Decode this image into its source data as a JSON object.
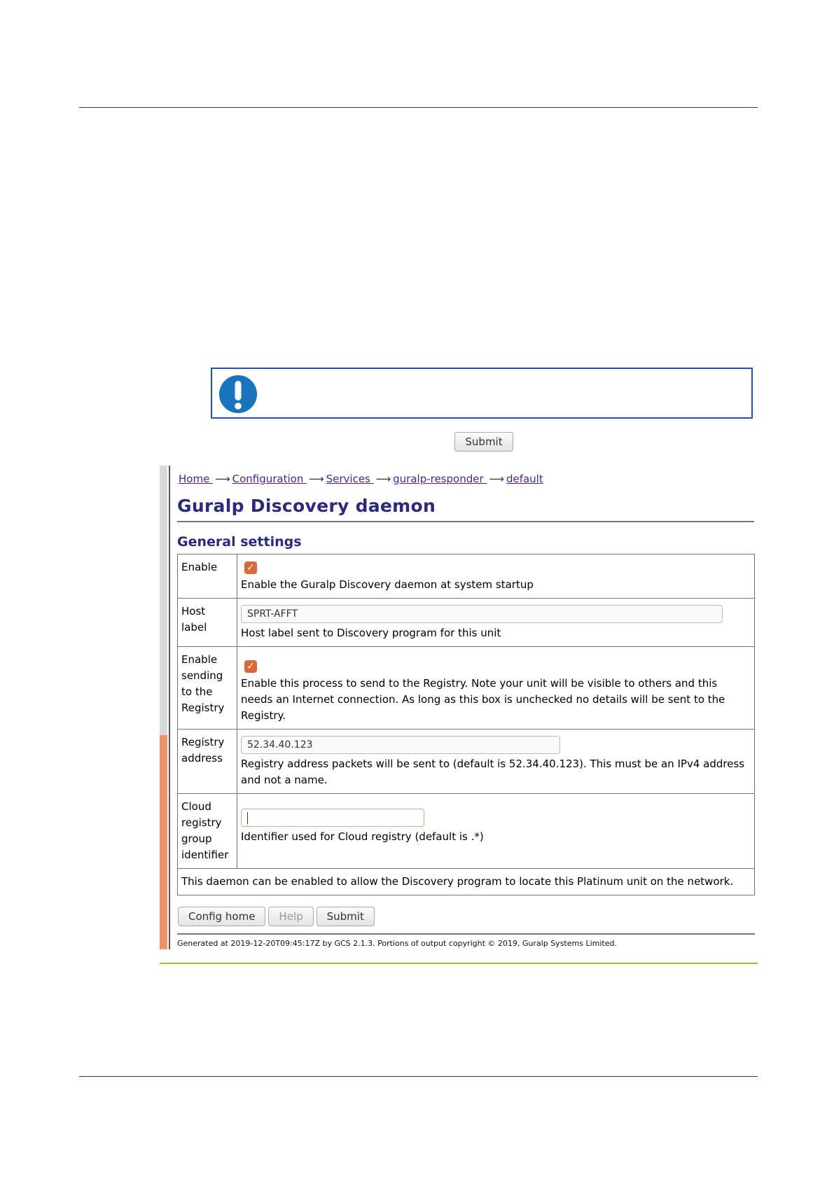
{
  "notice": {
    "icon": "exclamation-icon",
    "icon_color": "#1a73bd"
  },
  "top_submit_label": "Submit",
  "screenshot": {
    "breadcrumb": [
      {
        "label": "Home "
      },
      {
        "label": "Configuration "
      },
      {
        "label": "Services "
      },
      {
        "label": "guralp-responder "
      },
      {
        "label": "default"
      }
    ],
    "breadcrumb_arrow": "⟶",
    "title": "Guralp Discovery daemon",
    "section": "General settings",
    "rows": {
      "enable": {
        "label": "Enable",
        "checked": true,
        "description": "Enable the Guralp Discovery daemon at system startup"
      },
      "host_label": {
        "label": "Host label",
        "value": "SPRT-AFFT",
        "description": "Host label sent to Discovery program for this unit"
      },
      "registry": {
        "label": "Enable sending to the Registry",
        "checked": true,
        "description": "Enable this process to send to the Registry. Note your unit will be visible to others and this needs an Internet connection. As long as this box is unchecked no details will be sent to the Registry."
      },
      "registry_address": {
        "label": "Registry address",
        "value": "52.34.40.123",
        "description": "Registry address packets will be sent to (default is 52.34.40.123). This must be an IPv4 address and not a name."
      },
      "cloud_group": {
        "label": "Cloud registry group identifier",
        "value": "",
        "description": "Identifier used for Cloud registry (default is .*)"
      }
    },
    "note": "This daemon can be enabled to allow the Discovery program to locate this Platinum unit on the network.",
    "buttons": {
      "config_home": "Config home",
      "help": "Help",
      "submit": "Submit"
    },
    "footer": "Generated at 2019-12-20T09:45:17Z by GCS 2.1.3. Portions of output copyright © 2019, Guralp Systems Limited."
  }
}
